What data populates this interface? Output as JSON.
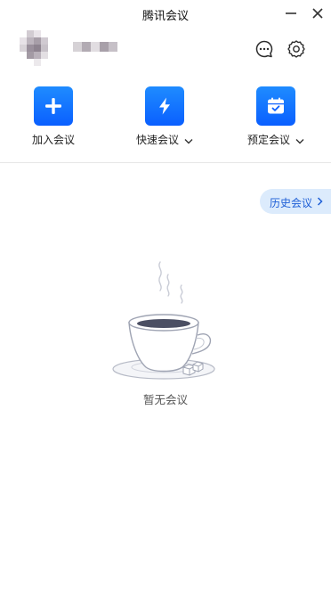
{
  "window": {
    "title": "腾讯会议"
  },
  "actions": [
    {
      "label": "加入会议",
      "icon": "plus-icon"
    },
    {
      "label": "快速会议",
      "icon": "lightning-icon",
      "has_dropdown": true
    },
    {
      "label": "预定会议",
      "icon": "calendar-icon",
      "has_dropdown": true
    }
  ],
  "history": {
    "label": "历史会议"
  },
  "empty_state": {
    "text": "暂无会议",
    "illustration": "coffee-cup"
  },
  "colors": {
    "accent": "#0a5fff",
    "history_bg": "#dcebfc",
    "history_text": "#1e5fd6"
  }
}
